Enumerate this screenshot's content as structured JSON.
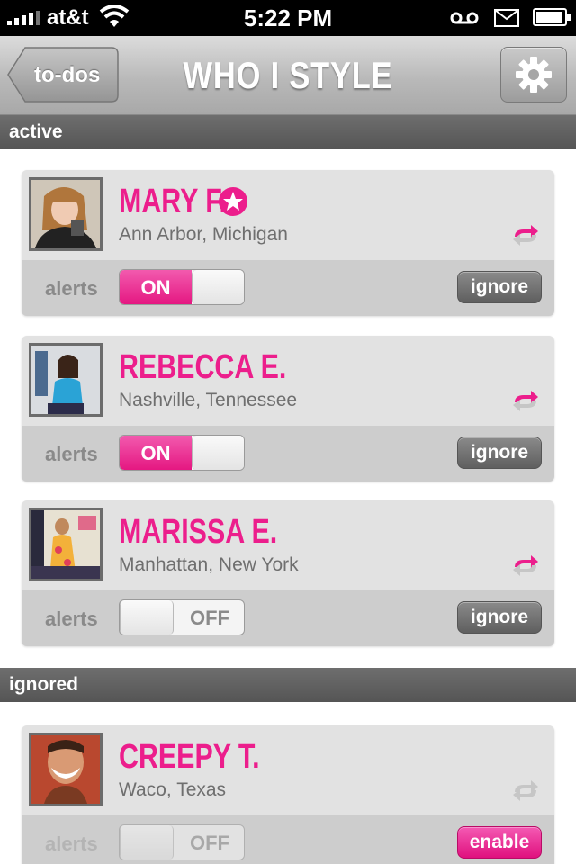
{
  "status_bar": {
    "carrier": "at&t",
    "time": "5:22 PM"
  },
  "nav": {
    "back_label": "to-dos",
    "title": "WHO I STYLE"
  },
  "sections": {
    "active": "active",
    "ignored": "ignored"
  },
  "common": {
    "alerts_label": "alerts",
    "on_label": "ON",
    "off_label": "OFF",
    "ignore_label": "ignore",
    "enable_label": "enable"
  },
  "clients": [
    {
      "name": "MARY F.",
      "location": "Ann Arbor, Michigan",
      "alerts": "ON",
      "starred": true
    },
    {
      "name": "REBECCA E.",
      "location": "Nashville, Tennessee",
      "alerts": "ON",
      "starred": false
    },
    {
      "name": "MARISSA E.",
      "location": "Manhattan, New York",
      "alerts": "OFF",
      "starred": false
    }
  ],
  "ignored_clients": [
    {
      "name": "CREEPY T.",
      "location": "Waco, Texas",
      "alerts": "OFF"
    }
  ],
  "colors": {
    "accent": "#ec1e8c",
    "header_bg": "#5e5e5e",
    "card_bg": "#e2e2e2"
  },
  "icons": [
    "signal-icon",
    "wifi-icon",
    "voicemail-icon",
    "mail-icon",
    "battery-icon",
    "back-arrow-icon",
    "gear-icon",
    "star-icon",
    "sync-icon"
  ]
}
